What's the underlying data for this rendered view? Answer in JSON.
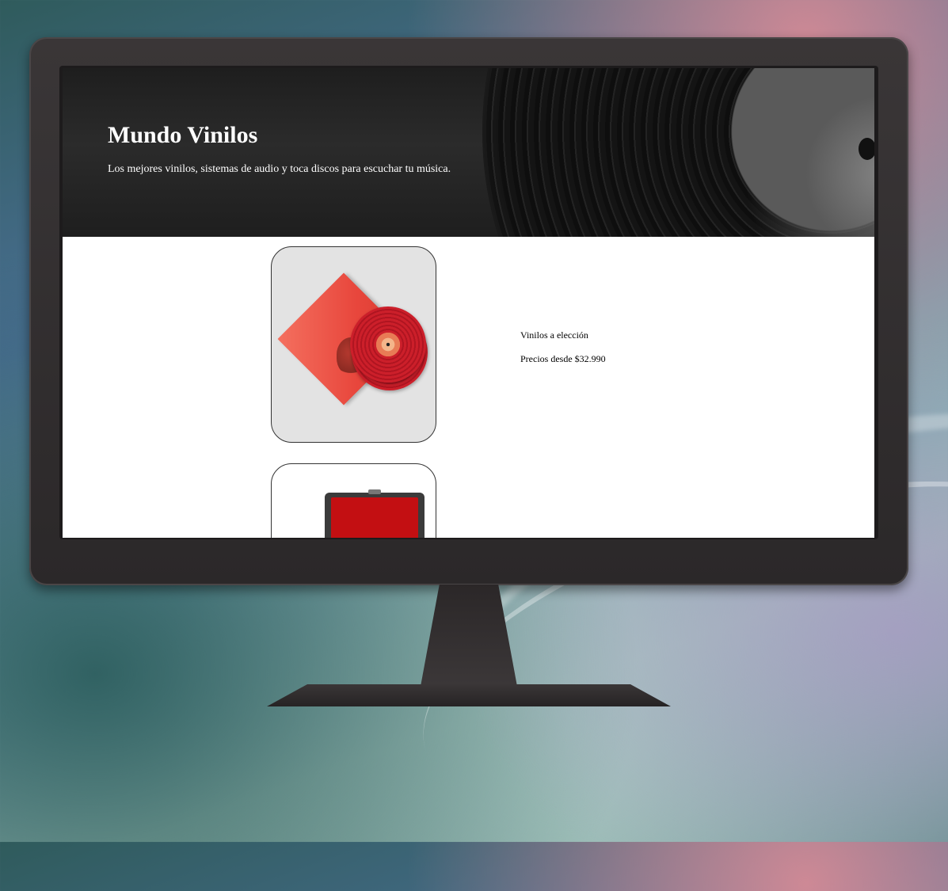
{
  "site": {
    "title": "Mundo Vinilos",
    "subtitle": "Los mejores vinilos, sistemas de audio y toca discos para escuchar tu música."
  },
  "products": [
    {
      "image_alt": "red vinyl record with sleeve",
      "name": "Vinilos a elección",
      "price": "Precios desde $32.990"
    },
    {
      "image_alt": "red turntable case"
    }
  ],
  "colors": {
    "hero_background": "#1e1e1e",
    "screen_background": "#ffffff",
    "monitor_frame": "#2b2829",
    "text_dark": "#000000",
    "text_light": "#ffffff"
  }
}
